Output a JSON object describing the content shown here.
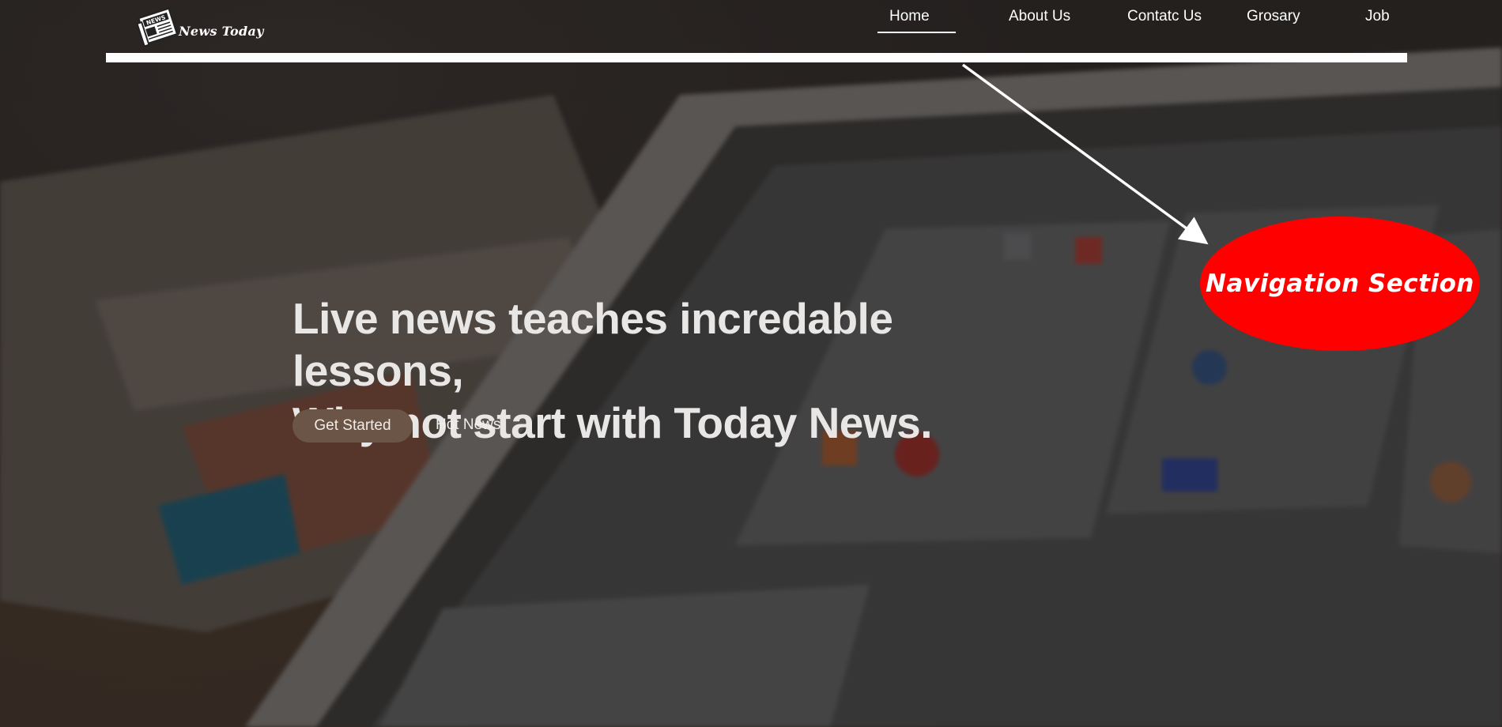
{
  "header": {
    "logo_text": "News Today",
    "logo_icon": "newspaper-icon"
  },
  "nav": {
    "items": [
      {
        "label": "Home",
        "active": true
      },
      {
        "label": "About Us",
        "active": false
      },
      {
        "label": "Contatc Us",
        "active": false
      },
      {
        "label": "Grosary",
        "active": false
      },
      {
        "label": "Job",
        "active": false
      }
    ]
  },
  "annotation": {
    "label": "Navigation Section",
    "color": "#ff0000"
  },
  "hero": {
    "title_line1": "Live news teaches incredable lessons,",
    "title_line2": "Why not start with Today News.",
    "primary_button": "Get Started",
    "secondary_link": "Hot News",
    "button_color": "#6b5546"
  }
}
